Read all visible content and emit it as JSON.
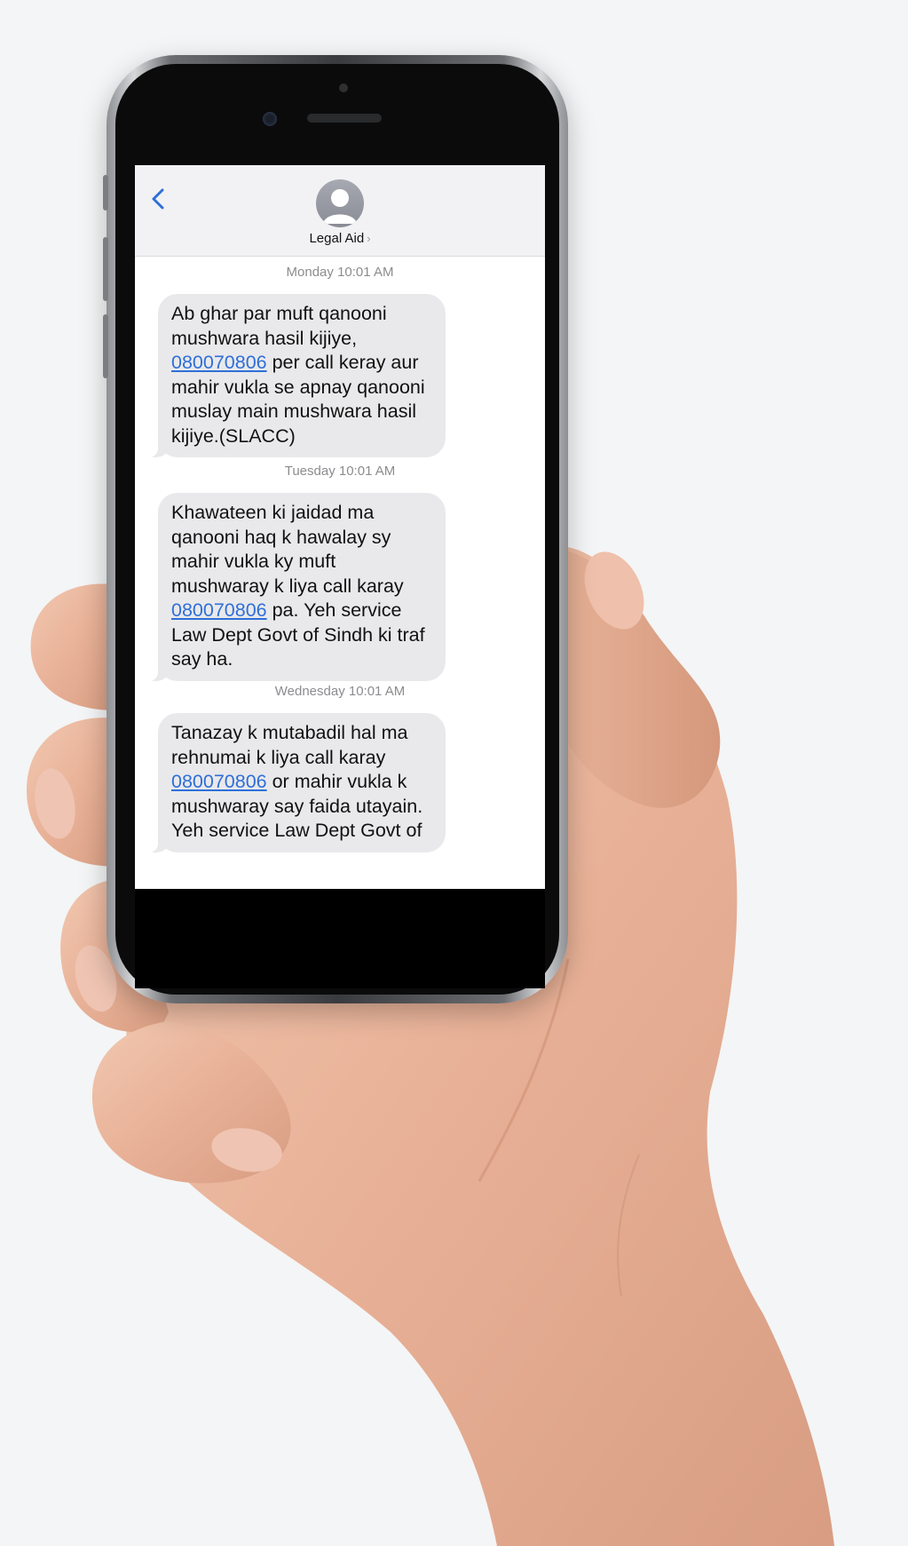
{
  "header": {
    "contact_name": "Legal Aid",
    "contact_chevron": "›",
    "back_icon": "chevron-left-icon",
    "avatar_icon": "person-avatar-icon"
  },
  "messages": [
    {
      "timestamp": "Monday 10:01 AM",
      "text_before": "Ab ghar par muft qanooni mushwara hasil kijiye,",
      "phone_link": "080070806",
      "text_after": " per call keray aur mahir vukla se apnay qanooni muslay main mushwara hasil kijiye.(SLACC)"
    },
    {
      "timestamp": "Tuesday 10:01 AM",
      "text_before": "Khawateen ki jaidad ma qanooni haq k hawalay sy mahir vukla ky muft mushwaray k liya call karay",
      "phone_link": "080070806",
      "text_after": " pa. Yeh service Law Dept Govt of Sindh ki traf say ha."
    },
    {
      "timestamp": "Wednesday 10:01 AM",
      "text_before": "Tanazay k mutabadil hal ma rehnumai k liya call karay",
      "phone_link": "080070806",
      "text_after": " or mahir vukla k mushwaray say faida utayain. Yeh service Law Dept Govt of"
    }
  ],
  "colors": {
    "link": "#2f6fd8",
    "bubble": "#e9e9eb",
    "nav_bar": "#f2f2f5",
    "timestamp": "#8c8c90"
  }
}
